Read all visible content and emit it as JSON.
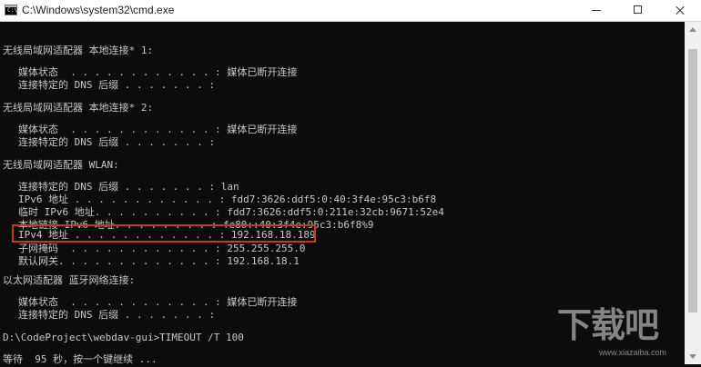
{
  "window": {
    "title": "C:\\Windows\\system32\\cmd.exe",
    "icon": "cmd-icon"
  },
  "console": {
    "lines": [
      "无线局域网适配器 本地连接* 1:",
      "媒体状态  . . . . . . . . . . . . : 媒体已断开连接",
      "连接特定的 DNS 后缀 . . . . . . . :",
      "无线局域网适配器 本地连接* 2:",
      "媒体状态  . . . . . . . . . . . . : 媒体已断开连接",
      "连接特定的 DNS 后缀 . . . . . . . :",
      "无线局域网适配器 WLAN:",
      "连接特定的 DNS 后缀 . . . . . . . : lan",
      "IPv6 地址 . . . . . . . . . . . . : fdd7:3626:ddf5:0:40:3f4e:95c3:b6f8",
      "临时 IPv6 地址. . . . . . . . . . : fdd7:3626:ddf5:0:211e:32cb:9671:52e4",
      "本地链接 IPv6 地址. . . . . . . . : fe80::40:3f4e:95c3:b6f8%9",
      "IPv4 地址 . . . . . . . . . . . . : 192.168.18.189",
      "子网掩码  . . . . . . . . . . . . : 255.255.255.0",
      "默认网关. . . . . . . . . . . . . : 192.168.18.1",
      "以太网适配器 蓝牙网络连接:",
      "媒体状态  . . . . . . . . . . . . : 媒体已断开连接",
      "连接特定的 DNS 后缀 . . . . . . . :",
      "D:\\CodeProject\\webdav-gui>TIMEOUT /T 100",
      "等待  95 秒，按一个键继续 ..."
    ]
  },
  "watermark": {
    "logo": "下载吧",
    "url": "www.xiazaiba.com"
  },
  "colors": {
    "console_bg": "#0c0c0c",
    "console_text": "#c8c8c8",
    "highlight_border": "#c0392b"
  }
}
